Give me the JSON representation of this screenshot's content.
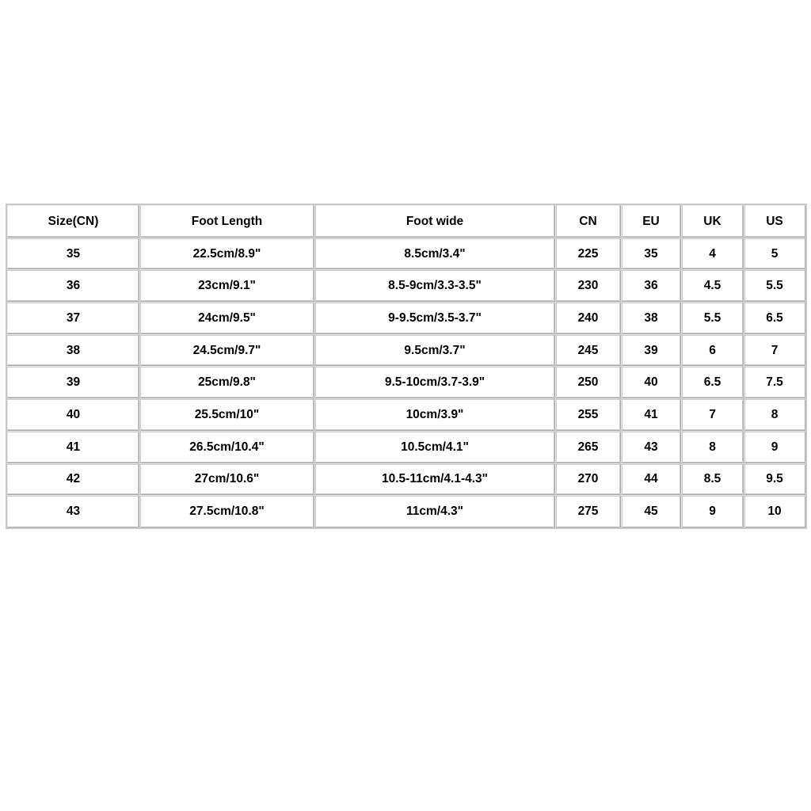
{
  "table": {
    "name": "shoe-size-conversion-chart",
    "columns": [
      {
        "key": "size_cn",
        "label": "Size(CN)"
      },
      {
        "key": "foot_length",
        "label": "Foot Length"
      },
      {
        "key": "foot_wide",
        "label": "Foot wide"
      },
      {
        "key": "cn",
        "label": "CN"
      },
      {
        "key": "eu",
        "label": "EU"
      },
      {
        "key": "uk",
        "label": "UK"
      },
      {
        "key": "us",
        "label": "US"
      }
    ],
    "rows": [
      {
        "size_cn": "35",
        "foot_length": "22.5cm/8.9\"",
        "foot_wide": "8.5cm/3.4\"",
        "cn": "225",
        "eu": "35",
        "uk": "4",
        "us": "5"
      },
      {
        "size_cn": "36",
        "foot_length": "23cm/9.1\"",
        "foot_wide": "8.5-9cm/3.3-3.5\"",
        "cn": "230",
        "eu": "36",
        "uk": "4.5",
        "us": "5.5"
      },
      {
        "size_cn": "37",
        "foot_length": "24cm/9.5\"",
        "foot_wide": "9-9.5cm/3.5-3.7\"",
        "cn": "240",
        "eu": "38",
        "uk": "5.5",
        "us": "6.5"
      },
      {
        "size_cn": "38",
        "foot_length": "24.5cm/9.7\"",
        "foot_wide": "9.5cm/3.7\"",
        "cn": "245",
        "eu": "39",
        "uk": "6",
        "us": "7"
      },
      {
        "size_cn": "39",
        "foot_length": "25cm/9.8\"",
        "foot_wide": "9.5-10cm/3.7-3.9\"",
        "cn": "250",
        "eu": "40",
        "uk": "6.5",
        "us": "7.5"
      },
      {
        "size_cn": "40",
        "foot_length": "25.5cm/10\"",
        "foot_wide": "10cm/3.9\"",
        "cn": "255",
        "eu": "41",
        "uk": "7",
        "us": "8"
      },
      {
        "size_cn": "41",
        "foot_length": "26.5cm/10.4\"",
        "foot_wide": "10.5cm/4.1\"",
        "cn": "265",
        "eu": "43",
        "uk": "8",
        "us": "9"
      },
      {
        "size_cn": "42",
        "foot_length": "27cm/10.6\"",
        "foot_wide": "10.5-11cm/4.1-4.3\"",
        "cn": "270",
        "eu": "44",
        "uk": "8.5",
        "us": "9.5"
      },
      {
        "size_cn": "43",
        "foot_length": "27.5cm/10.8\"",
        "foot_wide": "11cm/4.3\"",
        "cn": "275",
        "eu": "45",
        "uk": "9",
        "us": "10"
      }
    ]
  },
  "colors": {
    "background": "#ffffff",
    "cell_background": "#ffffff",
    "border_light": "#eaeaea",
    "border_dark": "#a9a9a9",
    "border_outline": "#c9c9c9",
    "text": "#000000"
  }
}
